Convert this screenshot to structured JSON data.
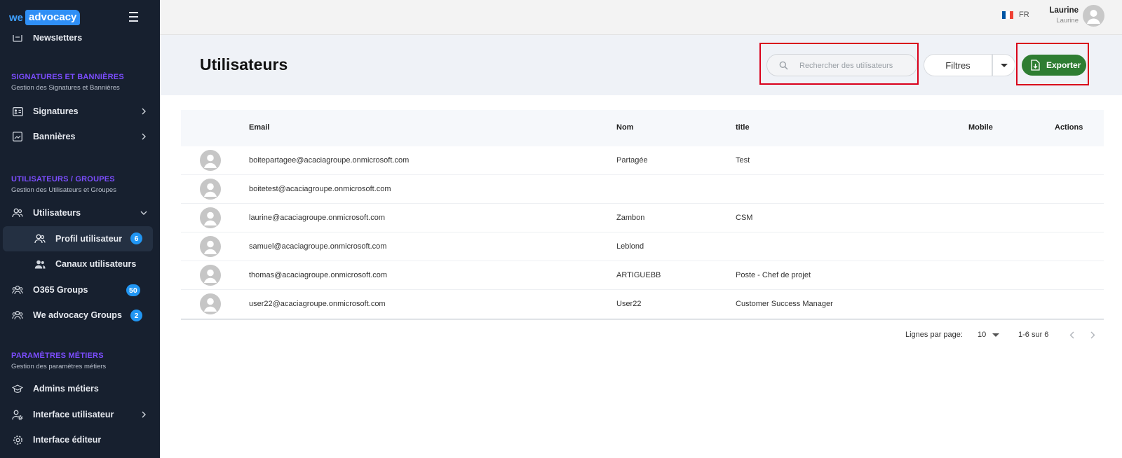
{
  "brand": {
    "we": "we",
    "advocacy": "advocacy"
  },
  "sidebar": {
    "partial_item": "Newsletters",
    "sections": [
      {
        "title": "SIGNATURES ET BANNIÈRES",
        "subtitle": "Gestion des Signatures et Bannières"
      },
      {
        "title": "UTILISATEURS / GROUPES",
        "subtitle": "Gestion des Utilisateurs et Groupes"
      },
      {
        "title": "PARAMÈTRES MÉTIERS",
        "subtitle": "Gestion des paramètres métiers"
      }
    ],
    "items": {
      "signatures": "Signatures",
      "bannieres": "Bannières",
      "utilisateurs": "Utilisateurs",
      "profil": "Profil utilisateur",
      "profil_badge": "6",
      "canaux": "Canaux utilisateurs",
      "o365": "O365 Groups",
      "o365_badge": "50",
      "wegroups": "We advocacy Groups",
      "wegroups_badge": "2",
      "admins": "Admins métiers",
      "interface_user": "Interface utilisateur",
      "interface_editor": "Interface éditeur"
    }
  },
  "topbar": {
    "lang": "FR",
    "user_name": "Laurine",
    "user_sub": "Laurine",
    "flag_colors": [
      "#0055a4",
      "#ffffff",
      "#ef4135"
    ]
  },
  "page": {
    "title": "Utilisateurs",
    "search_placeholder": "Rechercher des utilisateurs",
    "filters_label": "Filtres",
    "export_label": "Exporter"
  },
  "table": {
    "columns": {
      "email": "Email",
      "nom": "Nom",
      "title": "title",
      "mobile": "Mobile",
      "actions": "Actions"
    },
    "rows": [
      {
        "email": "boitepartagee@acaciagroupe.onmicrosoft.com",
        "nom": "Partagée",
        "title": "Test",
        "mobile": ""
      },
      {
        "email": "boitetest@acaciagroupe.onmicrosoft.com",
        "nom": "",
        "title": "",
        "mobile": ""
      },
      {
        "email": "laurine@acaciagroupe.onmicrosoft.com",
        "nom": "Zambon",
        "title": "CSM",
        "mobile": ""
      },
      {
        "email": "samuel@acaciagroupe.onmicrosoft.com",
        "nom": "Leblond",
        "title": "",
        "mobile": ""
      },
      {
        "email": "thomas@acaciagroupe.onmicrosoft.com",
        "nom": "ARTIGUEBB",
        "title": "Poste - Chef de projet",
        "mobile": ""
      },
      {
        "email": "user22@acaciagroupe.onmicrosoft.com",
        "nom": "User22",
        "title": "Customer Success Manager",
        "mobile": ""
      }
    ]
  },
  "pagination": {
    "rows_label": "Lignes par page:",
    "rows_value": "10",
    "range": "1-6 sur 6"
  },
  "colors": {
    "sidebar_bg": "#17202f",
    "accent_purple": "#7c4dff",
    "badge_blue": "#2196f3",
    "export_green": "#2e7d32",
    "highlight_red": "#d9001b"
  }
}
